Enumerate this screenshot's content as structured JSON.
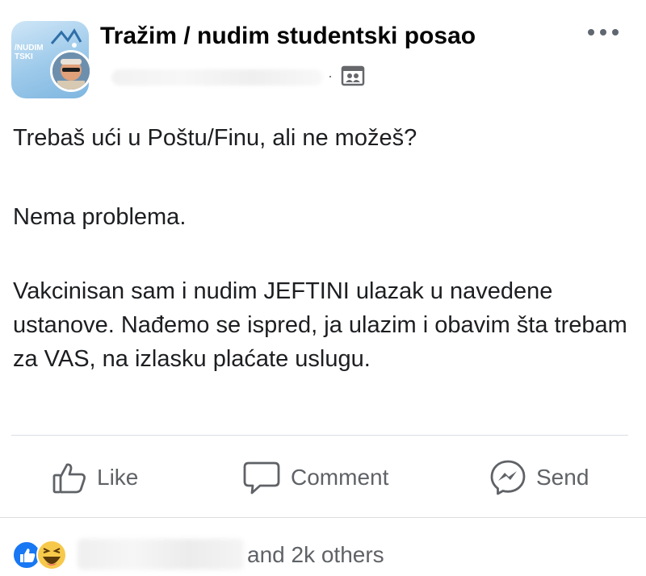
{
  "post": {
    "group_name": "Tražim / nudim studentski posao",
    "group_avatar_text": [
      "/NUDIM",
      "TSKI"
    ],
    "body": {
      "line1": "Trebaš ući u Poštu/Finu, ali ne možeš?",
      "line2": "Nema problema.",
      "line3": "Vakcinisan sam i nudim JEFTINI ulazak u navedene ustanove. Nađemo se ispred, ja ulazim i obavim šta trebam za VAS, na izlasku plaćate uslugu."
    },
    "header_icons": [
      "more-options-icon",
      "group-audience-icon"
    ]
  },
  "actions": {
    "like_label": "Like",
    "comment_label": "Comment",
    "send_label": "Send",
    "icons": [
      "thumbs-up-icon",
      "comment-bubble-icon",
      "messenger-icon"
    ]
  },
  "reactions": {
    "icons": [
      "like-reaction-icon",
      "haha-reaction-icon"
    ],
    "count_text": "and 2k others"
  },
  "colors": {
    "text": "#1c1e21",
    "secondary_text": "#5f6266",
    "like_blue": "#1877f2",
    "haha_yellow": "#f7c94b",
    "divider": "#dadde1"
  }
}
